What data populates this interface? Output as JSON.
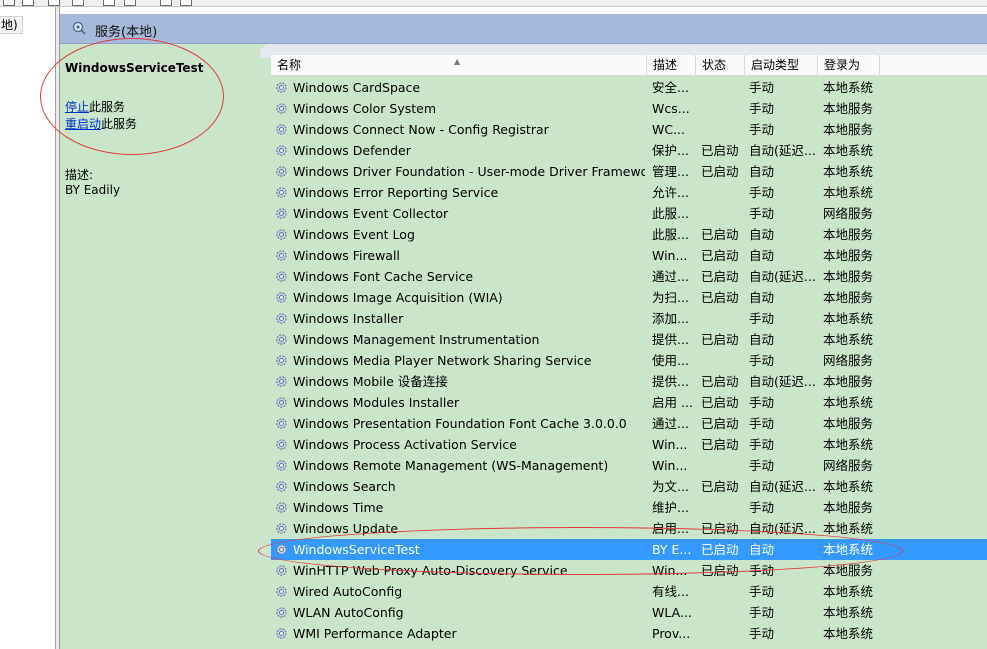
{
  "tree": {
    "selected_label": "地)"
  },
  "pane": {
    "title": "服务(本地)"
  },
  "details": {
    "service_name": "WindowsServiceTest",
    "stop_link": "停止",
    "stop_suffix": "此服务",
    "restart_link": "重启动",
    "restart_suffix": "此服务",
    "description_label": "描述:",
    "description": "BY Eadily"
  },
  "columns": {
    "name": "名称",
    "description": "描述",
    "status": "状态",
    "startup_type": "启动类型",
    "log_on_as": "登录为"
  },
  "services": [
    {
      "name": "Windows CardSpace",
      "desc": "安全...",
      "state": "",
      "start": "手动",
      "logon": "本地系统"
    },
    {
      "name": "Windows Color System",
      "desc": "Wcs...",
      "state": "",
      "start": "手动",
      "logon": "本地服务"
    },
    {
      "name": "Windows Connect Now - Config Registrar",
      "desc": "WC...",
      "state": "",
      "start": "手动",
      "logon": "本地服务"
    },
    {
      "name": "Windows Defender",
      "desc": "保护...",
      "state": "已启动",
      "start": "自动(延迟...",
      "logon": "本地系统"
    },
    {
      "name": "Windows Driver Foundation - User-mode Driver Framework",
      "desc": "管理...",
      "state": "已启动",
      "start": "自动",
      "logon": "本地系统"
    },
    {
      "name": "Windows Error Reporting Service",
      "desc": "允许...",
      "state": "",
      "start": "手动",
      "logon": "本地系统"
    },
    {
      "name": "Windows Event Collector",
      "desc": "此服...",
      "state": "",
      "start": "手动",
      "logon": "网络服务"
    },
    {
      "name": "Windows Event Log",
      "desc": "此服...",
      "state": "已启动",
      "start": "自动",
      "logon": "本地服务"
    },
    {
      "name": "Windows Firewall",
      "desc": "Win...",
      "state": "已启动",
      "start": "自动",
      "logon": "本地服务"
    },
    {
      "name": "Windows Font Cache Service",
      "desc": "通过...",
      "state": "已启动",
      "start": "自动(延迟...",
      "logon": "本地服务"
    },
    {
      "name": "Windows Image Acquisition (WIA)",
      "desc": "为扫...",
      "state": "已启动",
      "start": "自动",
      "logon": "本地服务"
    },
    {
      "name": "Windows Installer",
      "desc": "添加...",
      "state": "",
      "start": "手动",
      "logon": "本地系统"
    },
    {
      "name": "Windows Management Instrumentation",
      "desc": "提供...",
      "state": "已启动",
      "start": "自动",
      "logon": "本地系统"
    },
    {
      "name": "Windows Media Player Network Sharing Service",
      "desc": "使用...",
      "state": "",
      "start": "手动",
      "logon": "网络服务"
    },
    {
      "name": "Windows Mobile 设备连接",
      "desc": "提供...",
      "state": "已启动",
      "start": "自动(延迟...",
      "logon": "本地服务"
    },
    {
      "name": "Windows Modules Installer",
      "desc": "启用 ...",
      "state": "已启动",
      "start": "手动",
      "logon": "本地系统"
    },
    {
      "name": "Windows Presentation Foundation Font Cache 3.0.0.0",
      "desc": "通过...",
      "state": "已启动",
      "start": "手动",
      "logon": "本地服务"
    },
    {
      "name": "Windows Process Activation Service",
      "desc": "Win...",
      "state": "已启动",
      "start": "手动",
      "logon": "本地系统"
    },
    {
      "name": "Windows Remote Management (WS-Management)",
      "desc": "Win...",
      "state": "",
      "start": "手动",
      "logon": "网络服务"
    },
    {
      "name": "Windows Search",
      "desc": "为文...",
      "state": "已启动",
      "start": "自动(延迟...",
      "logon": "本地系统"
    },
    {
      "name": "Windows Time",
      "desc": "维护...",
      "state": "",
      "start": "手动",
      "logon": "本地服务"
    },
    {
      "name": "Windows Update",
      "desc": "启用...",
      "state": "已启动",
      "start": "自动(延迟...",
      "logon": "本地系统"
    },
    {
      "name": "WindowsServiceTest",
      "desc": "BY E...",
      "state": "已启动",
      "start": "自动",
      "logon": "本地系统",
      "selected": true
    },
    {
      "name": "WinHTTP Web Proxy Auto-Discovery Service",
      "desc": "Win...",
      "state": "已启动",
      "start": "手动",
      "logon": "本地服务"
    },
    {
      "name": "Wired AutoConfig",
      "desc": "有线...",
      "state": "",
      "start": "手动",
      "logon": "本地系统"
    },
    {
      "name": "WLAN AutoConfig",
      "desc": "WLA...",
      "state": "",
      "start": "手动",
      "logon": "本地系统"
    },
    {
      "name": "WMI Performance Adapter",
      "desc": "Prov...",
      "state": "",
      "start": "手动",
      "logon": "本地系统"
    }
  ],
  "colors": {
    "pane_bg": "#cbe5cb",
    "header_bg": "#a7b9d9",
    "selection": "#3399ff",
    "link": "#0033cc",
    "annotation": "#e03a3a"
  }
}
